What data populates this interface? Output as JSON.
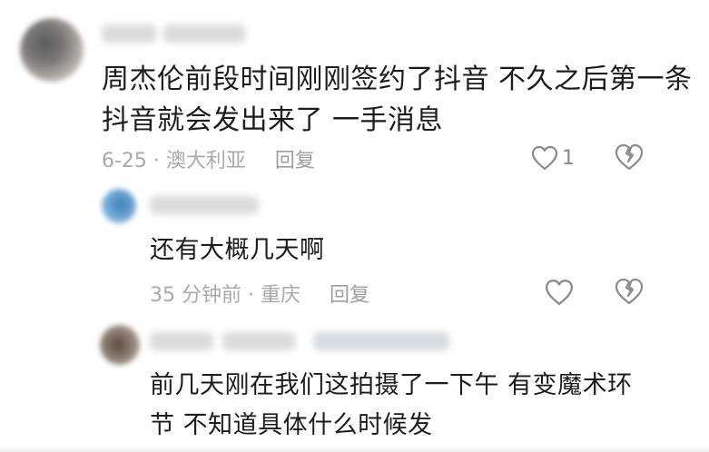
{
  "comments": [
    {
      "lines": [
        "周杰伦前段时间刚刚签约了抖音 不久之后第一条",
        "抖音就会发出来了 一手消息"
      ],
      "date": "6-25 · 澳大利亚",
      "reply_label": "回复",
      "like_count": "1",
      "like_icon": "heart-outline-icon",
      "dislike_icon": "broken-heart-icon"
    },
    {
      "lines": [
        "还有大概几天啊"
      ],
      "date": "35 分钟前 · 重庆",
      "reply_label": "回复",
      "like_icon": "heart-outline-icon",
      "dislike_icon": "broken-heart-icon"
    },
    {
      "lines": [
        "前几天刚在我们这拍摄了一下午 有变魔术环",
        "节 不知道具体什么时候发"
      ]
    }
  ],
  "colors": {
    "text": "#1c1c1c",
    "meta": "#a9a9a9",
    "icon": "#8c8c8c",
    "background": "#ffffff"
  }
}
